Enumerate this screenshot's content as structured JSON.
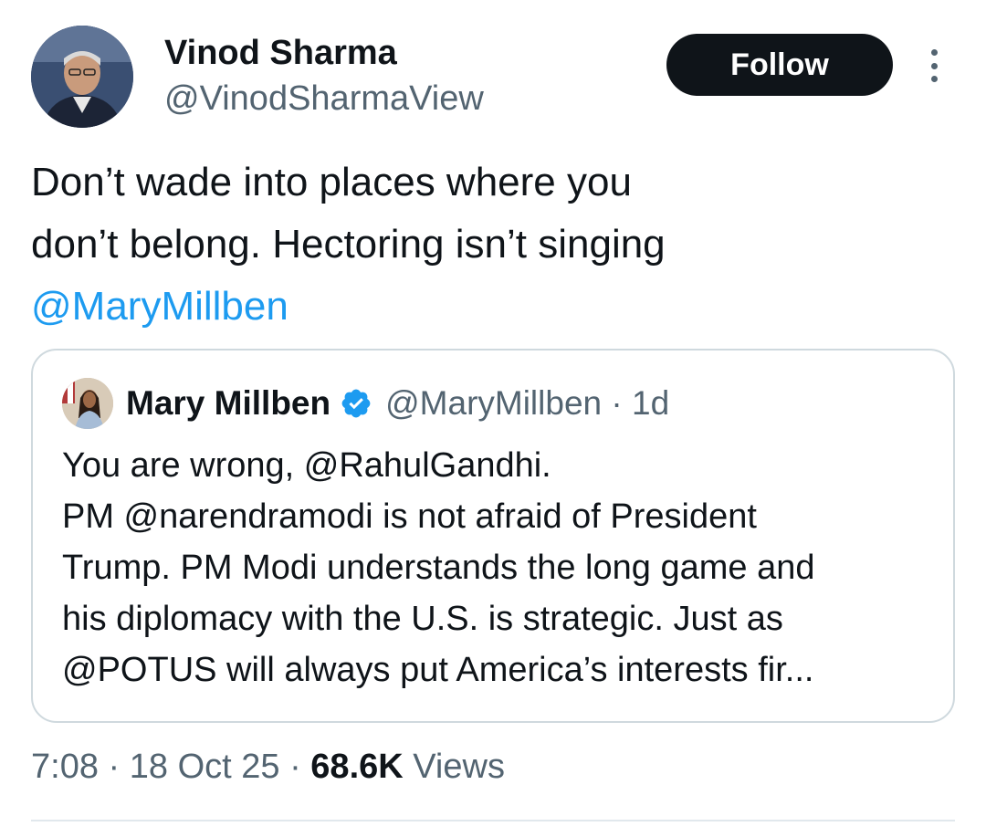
{
  "author": {
    "display_name": "Vinod Sharma",
    "handle": "@VinodSharmaView",
    "follow_label": "Follow",
    "avatar_icon": "profile-photo-man-glasses"
  },
  "tweet": {
    "text_line1": "Don’t wade into places where you",
    "text_line2": "don’t belong. Hectoring isn’t singing",
    "mention": "@MaryMillben"
  },
  "quote": {
    "display_name": "Mary Millben",
    "verified_icon": "verified-badge-icon",
    "meta": "@MaryMillben · 1d",
    "lines": [
      "You are wrong, @RahulGandhi.",
      "PM @narendramodi is not afraid of President",
      "Trump. PM Modi understands the long game and",
      "his diplomacy with the U.S. is strategic. Just as",
      "@POTUS will always put America’s interests fir..."
    ]
  },
  "footer": {
    "time": "7:08",
    "separator": " · ",
    "date": "18 Oct 25",
    "views_count": "68.6K",
    "views_label": "Views"
  },
  "colors": {
    "text": "#0f1419",
    "secondary": "#536471",
    "link": "#1d9bf0",
    "button_bg": "#0f1419",
    "border": "#cfd9de"
  }
}
